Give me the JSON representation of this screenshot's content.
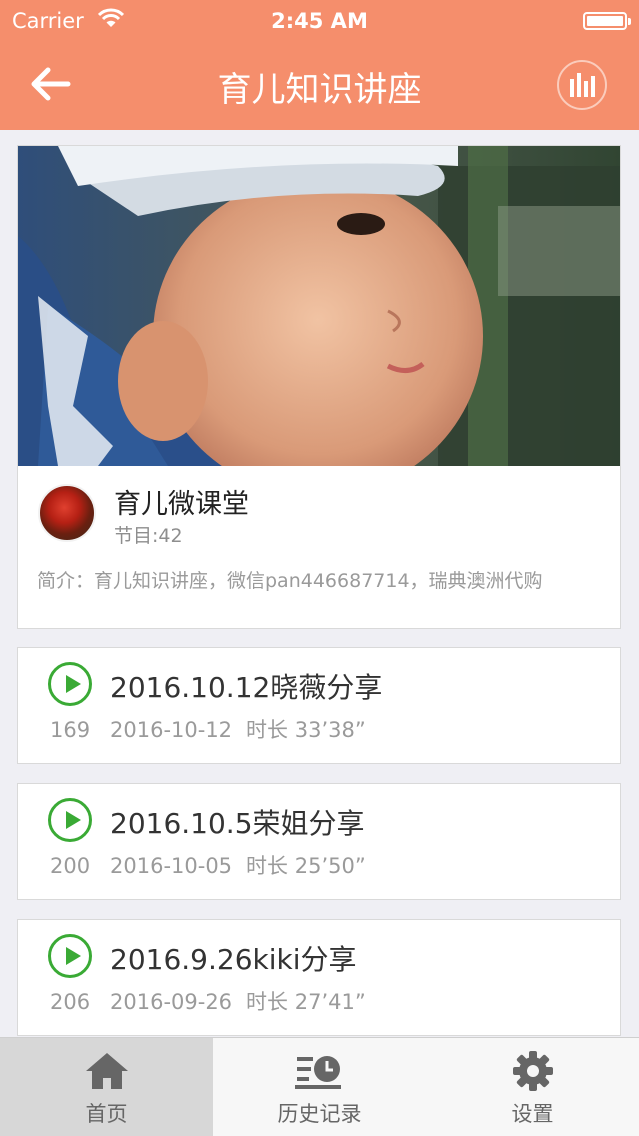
{
  "status_bar": {
    "carrier": "Carrier",
    "time": "2:45 AM"
  },
  "nav": {
    "title": "育儿知识讲座"
  },
  "channel": {
    "name": "育儿微课堂",
    "program_count": "节目:42",
    "intro": "简介：育儿知识讲座，微信pan446687714，瑞典澳洲代购"
  },
  "tracks": [
    {
      "title": "2016.10.12晓薇分享",
      "plays": "169",
      "date": "2016-10-12",
      "duration": "时长 33’38”"
    },
    {
      "title": "2016.10.5荣姐分享",
      "plays": "200",
      "date": "2016-10-05",
      "duration": "时长 25’50”"
    },
    {
      "title": "2016.9.26kiki分享",
      "plays": "206",
      "date": "2016-09-26",
      "duration": "时长 27’41”"
    }
  ],
  "tabs": [
    {
      "label": "首页",
      "icon": "home-icon"
    },
    {
      "label": "历史记录",
      "icon": "history-icon"
    },
    {
      "label": "设置",
      "icon": "gear-icon"
    }
  ],
  "colors": {
    "accent": "#f58e6c",
    "play": "#3aaa35"
  }
}
